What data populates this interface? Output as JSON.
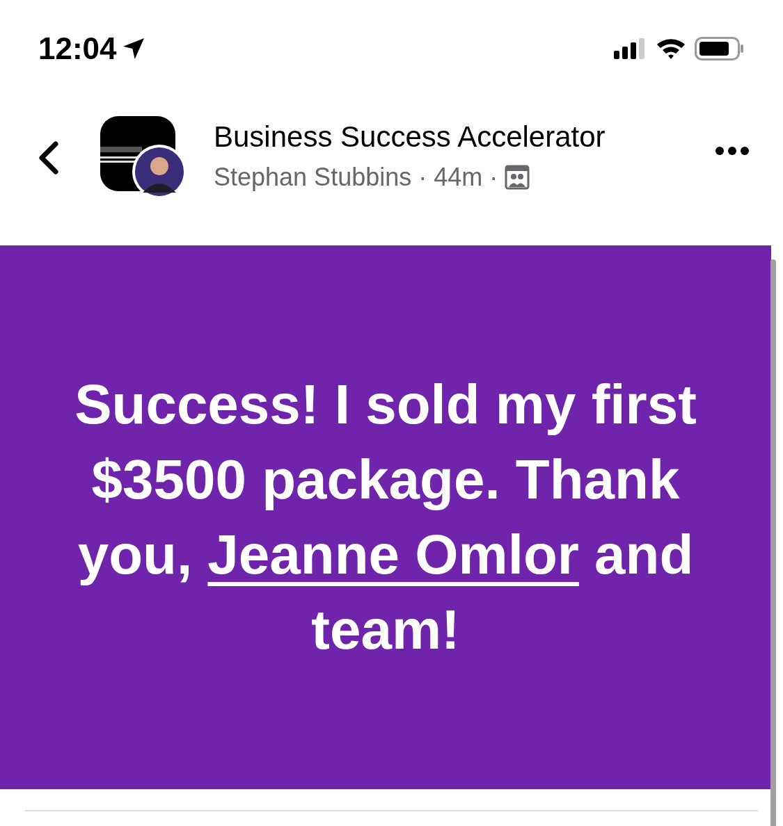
{
  "status_bar": {
    "time": "12:04"
  },
  "header": {
    "group_name": "Business Success Accelerator",
    "author": "Stephan Stubbins",
    "separator_1": "·",
    "time_ago": "44m",
    "separator_2": "·"
  },
  "post": {
    "kind": "picture_text",
    "text_before": "Success! I sold my first $3500 package. Thank you,",
    "mention": "Jeanne Omlor",
    "text_after": "and team!"
  }
}
